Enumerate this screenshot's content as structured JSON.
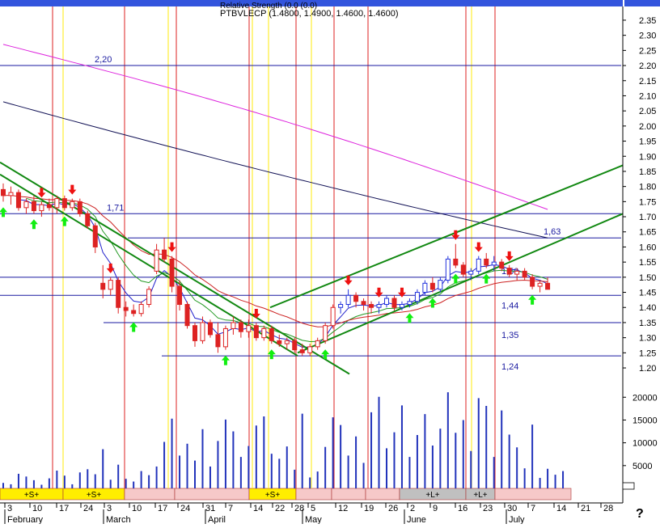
{
  "chart_data": {
    "type": "candlestick",
    "title": "PTBVLECP (1.4800, 1.4900, 1.4600, 1.4600)",
    "subtitle": "Relative Strength (0.0 (0.0)",
    "price_axis": {
      "ticks": [
        "2.35",
        "2.30",
        "2.25",
        "2.20",
        "2.15",
        "2.10",
        "2.05",
        "2.00",
        "1.95",
        "1.90",
        "1.85",
        "1.80",
        "1.75",
        "1.70",
        "1.65",
        "1.60",
        "1.55",
        "1.50",
        "1.45",
        "1.40",
        "1.35",
        "1.30",
        "1.25",
        "1.20"
      ],
      "range": [
        1.16,
        2.39
      ]
    },
    "volume_axis": {
      "ticks": [
        "20000",
        "15000",
        "10000",
        "5000"
      ],
      "range": [
        0,
        22000
      ]
    },
    "x_ticks": [
      "3",
      "10",
      "17",
      "24",
      "3",
      "10",
      "17",
      "24",
      "31",
      "7",
      "14",
      "22",
      "28",
      "5",
      "12",
      "19",
      "26",
      "2",
      "9",
      "16",
      "23",
      "30",
      "7",
      "14",
      "21",
      "28"
    ],
    "month_labels": [
      "February",
      "March",
      "April",
      "May",
      "June",
      "July"
    ],
    "horizontal_levels": [
      {
        "value": 2.2,
        "label": "2,20",
        "left": true
      },
      {
        "value": 1.71,
        "label": "1,71",
        "left": true
      },
      {
        "value": 1.63,
        "label": "1,63",
        "left": false
      },
      {
        "value": 1.5,
        "label": "1,50",
        "left": false
      },
      {
        "value": 1.44,
        "label": "1,44",
        "left": false
      },
      {
        "value": 1.35,
        "label": "1,35",
        "left": false
      },
      {
        "value": 1.24,
        "label": "1,24",
        "left": false
      }
    ],
    "signal_bands": [
      {
        "label": "+S+",
        "color": "#ffee00"
      },
      {
        "label": "+S+",
        "color": "#ffee00"
      },
      {
        "label": "",
        "color": "#f6c9c9"
      },
      {
        "label": "",
        "color": "#f6c9c9"
      },
      {
        "label": "+S+",
        "color": "#ffee00"
      },
      {
        "label": "",
        "color": "#f6c9c9"
      },
      {
        "label": "",
        "color": "#f6c9c9"
      },
      {
        "label": "",
        "color": "#f6c9c9"
      },
      {
        "label": "+L+",
        "color": "#c0c0c0"
      },
      {
        "label": "+L+",
        "color": "#c0c0c0"
      },
      {
        "label": "",
        "color": "#f6c9c9"
      }
    ],
    "candles": [
      {
        "o": 1.79,
        "h": 1.81,
        "l": 1.75,
        "c": 1.77
      },
      {
        "o": 1.77,
        "h": 1.8,
        "l": 1.74,
        "c": 1.78
      },
      {
        "o": 1.78,
        "h": 1.79,
        "l": 1.72,
        "c": 1.73
      },
      {
        "o": 1.73,
        "h": 1.76,
        "l": 1.71,
        "c": 1.75
      },
      {
        "o": 1.75,
        "h": 1.77,
        "l": 1.71,
        "c": 1.72
      },
      {
        "o": 1.72,
        "h": 1.75,
        "l": 1.7,
        "c": 1.74
      },
      {
        "o": 1.74,
        "h": 1.76,
        "l": 1.72,
        "c": 1.73
      },
      {
        "o": 1.73,
        "h": 1.77,
        "l": 1.71,
        "c": 1.76
      },
      {
        "o": 1.76,
        "h": 1.77,
        "l": 1.72,
        "c": 1.73
      },
      {
        "o": 1.73,
        "h": 1.76,
        "l": 1.72,
        "c": 1.75
      },
      {
        "o": 1.75,
        "h": 1.76,
        "l": 1.7,
        "c": 1.71
      },
      {
        "o": 1.71,
        "h": 1.72,
        "l": 1.66,
        "c": 1.67
      },
      {
        "o": 1.67,
        "h": 1.68,
        "l": 1.58,
        "c": 1.6
      },
      {
        "o": 1.48,
        "h": 1.54,
        "l": 1.43,
        "c": 1.46
      },
      {
        "o": 1.46,
        "h": 1.5,
        "l": 1.44,
        "c": 1.49
      },
      {
        "o": 1.49,
        "h": 1.5,
        "l": 1.38,
        "c": 1.4
      },
      {
        "o": 1.4,
        "h": 1.42,
        "l": 1.37,
        "c": 1.39
      },
      {
        "o": 1.39,
        "h": 1.41,
        "l": 1.37,
        "c": 1.38
      },
      {
        "o": 1.38,
        "h": 1.42,
        "l": 1.37,
        "c": 1.41
      },
      {
        "o": 1.41,
        "h": 1.47,
        "l": 1.4,
        "c": 1.46
      },
      {
        "o": 1.52,
        "h": 1.61,
        "l": 1.51,
        "c": 1.59
      },
      {
        "o": 1.59,
        "h": 1.63,
        "l": 1.55,
        "c": 1.56
      },
      {
        "o": 1.56,
        "h": 1.57,
        "l": 1.45,
        "c": 1.47
      },
      {
        "o": 1.47,
        "h": 1.49,
        "l": 1.39,
        "c": 1.41
      },
      {
        "o": 1.41,
        "h": 1.42,
        "l": 1.33,
        "c": 1.34
      },
      {
        "o": 1.34,
        "h": 1.35,
        "l": 1.27,
        "c": 1.29
      },
      {
        "o": 1.29,
        "h": 1.37,
        "l": 1.28,
        "c": 1.35
      },
      {
        "o": 1.35,
        "h": 1.36,
        "l": 1.3,
        "c": 1.31
      },
      {
        "o": 1.31,
        "h": 1.35,
        "l": 1.25,
        "c": 1.27
      },
      {
        "o": 1.27,
        "h": 1.34,
        "l": 1.26,
        "c": 1.33
      },
      {
        "o": 1.33,
        "h": 1.37,
        "l": 1.31,
        "c": 1.35
      },
      {
        "o": 1.35,
        "h": 1.36,
        "l": 1.3,
        "c": 1.32
      },
      {
        "o": 1.32,
        "h": 1.36,
        "l": 1.3,
        "c": 1.34
      },
      {
        "o": 1.34,
        "h": 1.35,
        "l": 1.29,
        "c": 1.3
      },
      {
        "o": 1.3,
        "h": 1.34,
        "l": 1.29,
        "c": 1.33
      },
      {
        "o": 1.33,
        "h": 1.34,
        "l": 1.28,
        "c": 1.29
      },
      {
        "o": 1.29,
        "h": 1.31,
        "l": 1.27,
        "c": 1.28
      },
      {
        "o": 1.28,
        "h": 1.3,
        "l": 1.26,
        "c": 1.29
      },
      {
        "o": 1.29,
        "h": 1.3,
        "l": 1.25,
        "c": 1.26
      },
      {
        "o": 1.26,
        "h": 1.28,
        "l": 1.24,
        "c": 1.25
      },
      {
        "o": 1.25,
        "h": 1.28,
        "l": 1.24,
        "c": 1.27
      },
      {
        "o": 1.27,
        "h": 1.3,
        "l": 1.26,
        "c": 1.29
      },
      {
        "o": 1.29,
        "h": 1.35,
        "l": 1.28,
        "c": 1.34
      },
      {
        "o": 1.34,
        "h": 1.41,
        "l": 1.33,
        "c": 1.4
      },
      {
        "o": 1.4,
        "h": 1.42,
        "l": 1.38,
        "c": 1.41
      },
      {
        "o": 1.41,
        "h": 1.46,
        "l": 1.4,
        "c": 1.44
      },
      {
        "o": 1.44,
        "h": 1.45,
        "l": 1.4,
        "c": 1.42
      },
      {
        "o": 1.42,
        "h": 1.43,
        "l": 1.39,
        "c": 1.41
      },
      {
        "o": 1.41,
        "h": 1.42,
        "l": 1.38,
        "c": 1.4
      },
      {
        "o": 1.4,
        "h": 1.42,
        "l": 1.38,
        "c": 1.41
      },
      {
        "o": 1.41,
        "h": 1.44,
        "l": 1.4,
        "c": 1.43
      },
      {
        "o": 1.43,
        "h": 1.44,
        "l": 1.39,
        "c": 1.4
      },
      {
        "o": 1.4,
        "h": 1.42,
        "l": 1.39,
        "c": 1.41
      },
      {
        "o": 1.41,
        "h": 1.43,
        "l": 1.4,
        "c": 1.42
      },
      {
        "o": 1.42,
        "h": 1.46,
        "l": 1.41,
        "c": 1.45
      },
      {
        "o": 1.45,
        "h": 1.49,
        "l": 1.44,
        "c": 1.48
      },
      {
        "o": 1.48,
        "h": 1.5,
        "l": 1.45,
        "c": 1.46
      },
      {
        "o": 1.46,
        "h": 1.5,
        "l": 1.45,
        "c": 1.49
      },
      {
        "o": 1.49,
        "h": 1.57,
        "l": 1.48,
        "c": 1.56
      },
      {
        "o": 1.56,
        "h": 1.61,
        "l": 1.53,
        "c": 1.54
      },
      {
        "o": 1.54,
        "h": 1.55,
        "l": 1.5,
        "c": 1.51
      },
      {
        "o": 1.51,
        "h": 1.53,
        "l": 1.49,
        "c": 1.52
      },
      {
        "o": 1.52,
        "h": 1.57,
        "l": 1.51,
        "c": 1.56
      },
      {
        "o": 1.56,
        "h": 1.58,
        "l": 1.53,
        "c": 1.54
      },
      {
        "o": 1.54,
        "h": 1.57,
        "l": 1.52,
        "c": 1.55
      },
      {
        "o": 1.55,
        "h": 1.56,
        "l": 1.52,
        "c": 1.53
      },
      {
        "o": 1.53,
        "h": 1.54,
        "l": 1.5,
        "c": 1.51
      },
      {
        "o": 1.51,
        "h": 1.53,
        "l": 1.49,
        "c": 1.52
      },
      {
        "o": 1.52,
        "h": 1.53,
        "l": 1.49,
        "c": 1.5
      },
      {
        "o": 1.5,
        "h": 1.51,
        "l": 1.46,
        "c": 1.47
      },
      {
        "o": 1.47,
        "h": 1.49,
        "l": 1.45,
        "c": 1.48
      },
      {
        "o": 1.48,
        "h": 1.5,
        "l": 1.46,
        "c": 1.46
      }
    ],
    "volumes": [
      1200,
      900,
      3200,
      2600,
      1800,
      800,
      2200,
      3900,
      2800,
      900,
      3500,
      4200,
      3100,
      8600,
      1900,
      5200,
      2100,
      1500,
      3800,
      2900,
      4800,
      10200,
      15300,
      7200,
      9800,
      6100,
      13000,
      4800,
      10400,
      15100,
      12500,
      6900,
      9300,
      13800,
      15800,
      7600,
      6500,
      9200,
      4100,
      16400,
      2400,
      3700,
      9100,
      15600,
      13900,
      7200,
      11400,
      5600,
      16700,
      20100,
      8800,
      12300,
      18200,
      6900,
      11700,
      16300,
      9400,
      13100,
      21100,
      12200,
      15000,
      8200,
      19800,
      18100,
      6900,
      17100,
      11800,
      9000,
      4400,
      14000,
      2300,
      4300,
      3000,
      3800
    ],
    "arrows_down": [
      5,
      9,
      14,
      22,
      33,
      45,
      49,
      52,
      59,
      62,
      66
    ],
    "arrows_up": [
      0,
      4,
      8,
      17,
      29,
      35,
      42,
      53,
      56,
      59,
      63,
      69
    ]
  }
}
